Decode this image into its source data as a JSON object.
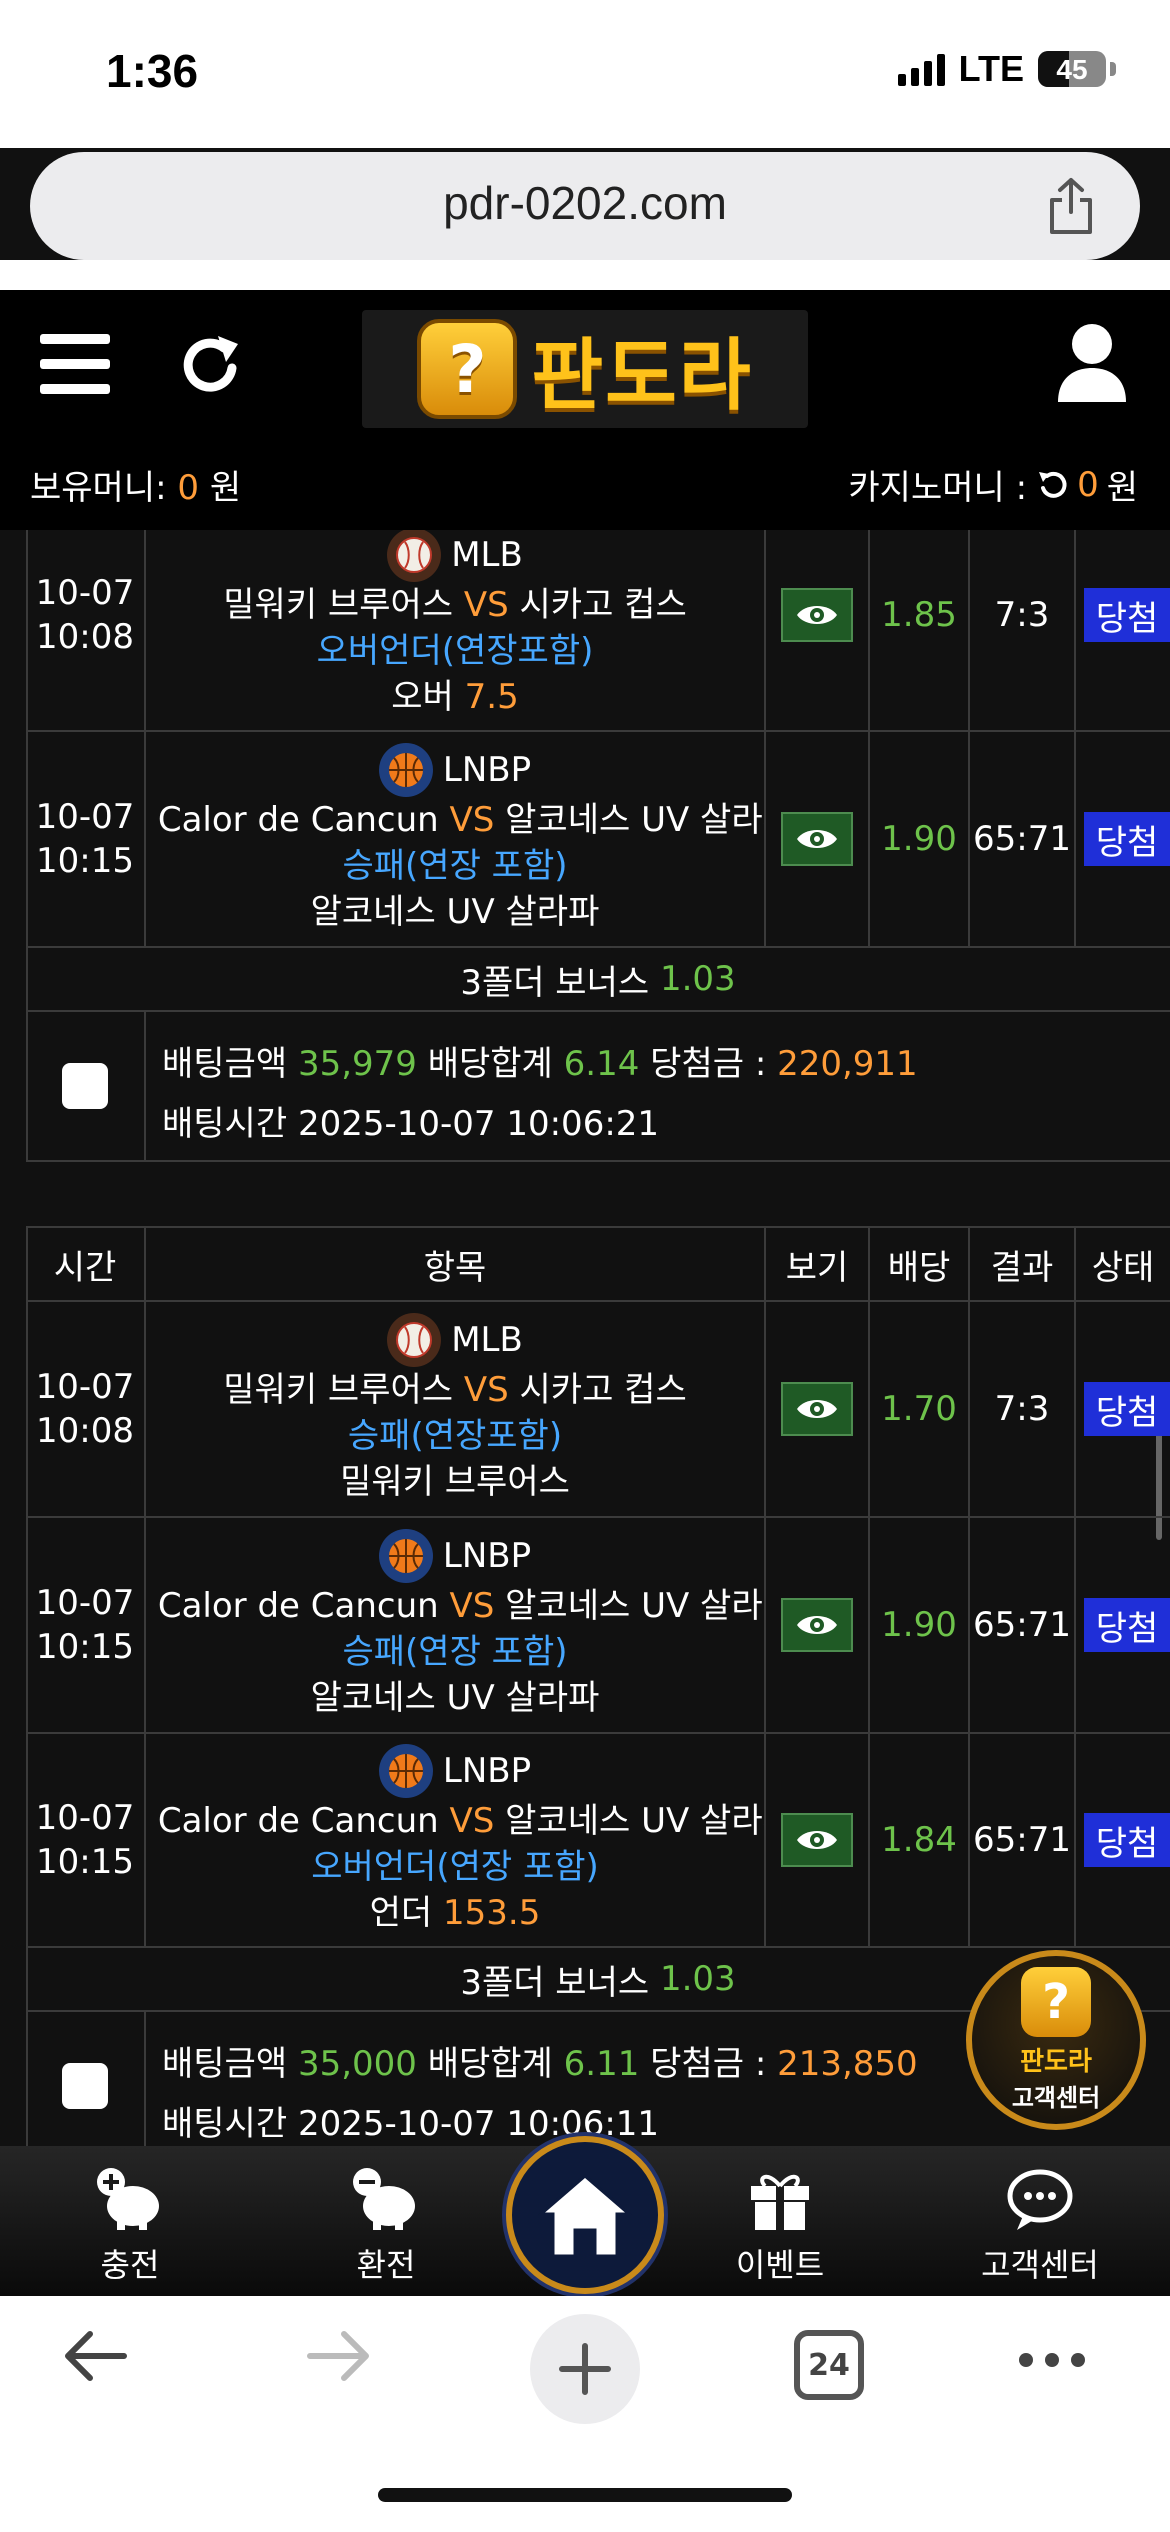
{
  "status_bar": {
    "time": "1:36",
    "network": "LTE",
    "battery": "45",
    "battery_level": 0.45
  },
  "browser": {
    "url": "pdr-0202.com",
    "tab_count": "24"
  },
  "header": {
    "logo_badge": "?",
    "logo_text": "판도라",
    "held_money_label": "보유머니:",
    "held_money_value": "0",
    "held_money_unit": "원",
    "casino_money_label": "카지노머니 :",
    "casino_money_value": "0",
    "casino_money_unit": "원"
  },
  "bet1": {
    "rows": [
      {
        "date": "10-07",
        "time": "10:08",
        "league": "MLB",
        "home": "밀워키 브루어스",
        "vs": "VS",
        "away": "시카고 컵스",
        "market": "오버언더(연장포함)",
        "pick": "오버",
        "pick_value": "7.5",
        "odds": "1.85",
        "result": "7:3",
        "status": "당첨"
      },
      {
        "date": "10-07",
        "time": "10:15",
        "league": "LNBP",
        "home": "El Calor de Cancun",
        "vs": "VS",
        "away": "알코네스 UV 살라파",
        "market": "승패(연장 포함)",
        "pick": "알코네스 UV 살라파",
        "pick_value": "",
        "odds": "1.90",
        "result": "65:71",
        "status": "당첨"
      }
    ],
    "bonus_label": "3폴더 보너스",
    "bonus_value": "1.03",
    "amount_label": "배팅금액",
    "amount": "35,979",
    "odds_total_label": "배당합계",
    "odds_total": "6.14",
    "win_label": "당첨금 :",
    "win": "220,911",
    "time_label": "배팅시간",
    "bet_time": "2025-10-07 10:06:21"
  },
  "table_header": {
    "time": "시간",
    "item": "항목",
    "view": "보기",
    "odds": "배당",
    "result": "결과",
    "status": "상태"
  },
  "bet2": {
    "rows": [
      {
        "date": "10-07",
        "time": "10:08",
        "league": "MLB",
        "home": "밀워키 브루어스",
        "vs": "VS",
        "away": "시카고 컵스",
        "market": "승패(연장포함)",
        "pick": "밀워키 브루어스",
        "pick_value": "",
        "odds": "1.70",
        "result": "7:3",
        "status": "당첨"
      },
      {
        "date": "10-07",
        "time": "10:15",
        "league": "LNBP",
        "home": "El Calor de Cancun",
        "vs": "VS",
        "away": "알코네스 UV 살라파",
        "market": "승패(연장 포함)",
        "pick": "알코네스 UV 살라파",
        "pick_value": "",
        "odds": "1.90",
        "result": "65:71",
        "status": "당첨"
      },
      {
        "date": "10-07",
        "time": "10:15",
        "league": "LNBP",
        "home": "El Calor de Cancun",
        "vs": "VS",
        "away": "알코네스 UV 살라파",
        "market": "오버언더(연장 포함)",
        "pick": "언더",
        "pick_value": "153.5",
        "odds": "1.84",
        "result": "65:71",
        "status": "당첨"
      }
    ],
    "bonus_label": "3폴더 보너스",
    "bonus_value": "1.03",
    "amount_label": "배팅금액",
    "amount": "35,000",
    "odds_total_label": "배당합계",
    "odds_total": "6.11",
    "win_label": "당첨금 :",
    "win": "213,850",
    "time_label": "배팅시간",
    "bet_time": "2025-10-07 10:06:11"
  },
  "floating": {
    "badge": "?",
    "line1": "판도라",
    "line2": "고객센터"
  },
  "bottom_nav": {
    "deposit": "충전",
    "withdraw": "환전",
    "event": "이벤트",
    "support": "고객센터"
  },
  "colors": {
    "accent_orange": "#ff9d3a",
    "odds_green": "#6ec34b",
    "market_blue": "#47a7ff",
    "win_badge": "#1f2fd8",
    "gold": "#c98a1a"
  }
}
